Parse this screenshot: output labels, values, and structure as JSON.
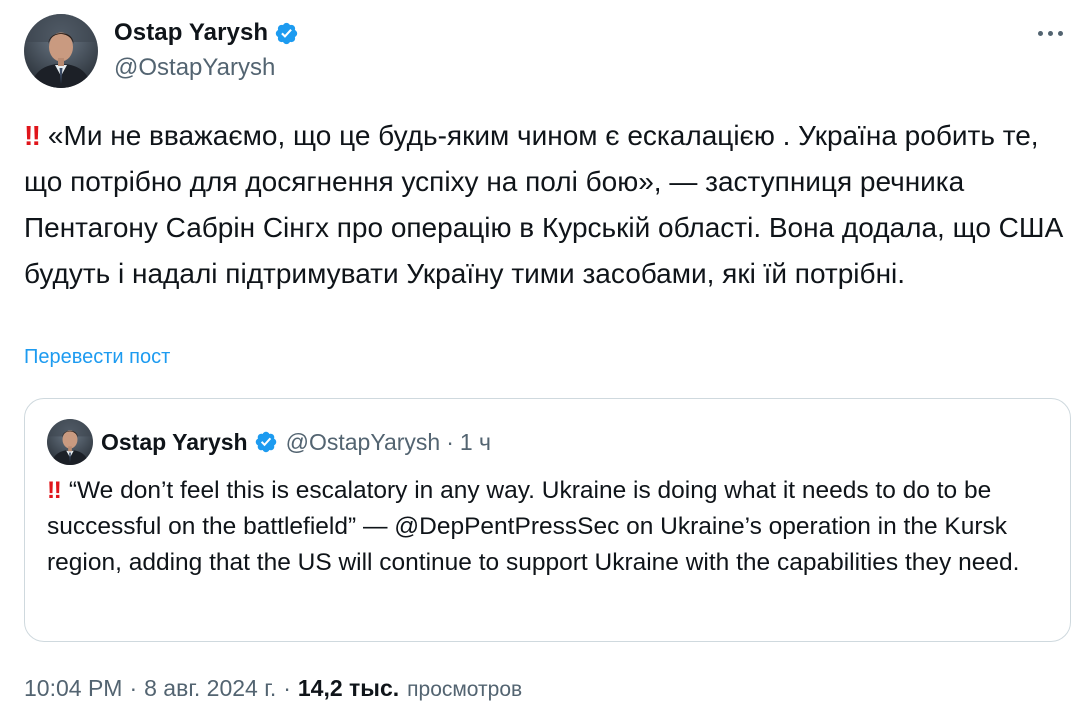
{
  "author": {
    "name": "Ostap Yarysh",
    "handle": "@OstapYarysh",
    "verified_color": "#1d9bf0"
  },
  "more_icon": "more-horizontal-icon",
  "tweet": {
    "emoji": "‼",
    "text": "«Ми не вважаємо, що це будь-яким чином є ескалацією . Україна робить те, що потрібно для досягнення успіху на полі бою», — заступниця речника Пентагону Сабрін Сінгх про операцію в Курській області. Вона додала, що США будуть і надалі підтримувати Україну тими засобами, які їй потрібні."
  },
  "translate_label": "Перевести пост",
  "quote": {
    "name": "Ostap Yarysh",
    "handle": "@OstapYarysh",
    "separator": "·",
    "time": "1 ч",
    "emoji": "‼",
    "text": "“We don’t feel this is escalatory in any way. Ukraine is doing what it needs to do to be successful on the battlefield” — @DepPentPressSec on Ukraine’s operation in the Kursk region, adding that the US will continue to support Ukraine with the capabilities they need."
  },
  "meta": {
    "time": "10:04 PM",
    "separator": "·",
    "date": "8 авг. 2024 г.",
    "views_count": "14,2 тыс.",
    "views_label": "просмотров"
  },
  "colors": {
    "text": "#0f1419",
    "secondary": "#536471",
    "link": "#1d9bf0",
    "border": "#cfd9de",
    "emoji_red": "#e0151b"
  }
}
